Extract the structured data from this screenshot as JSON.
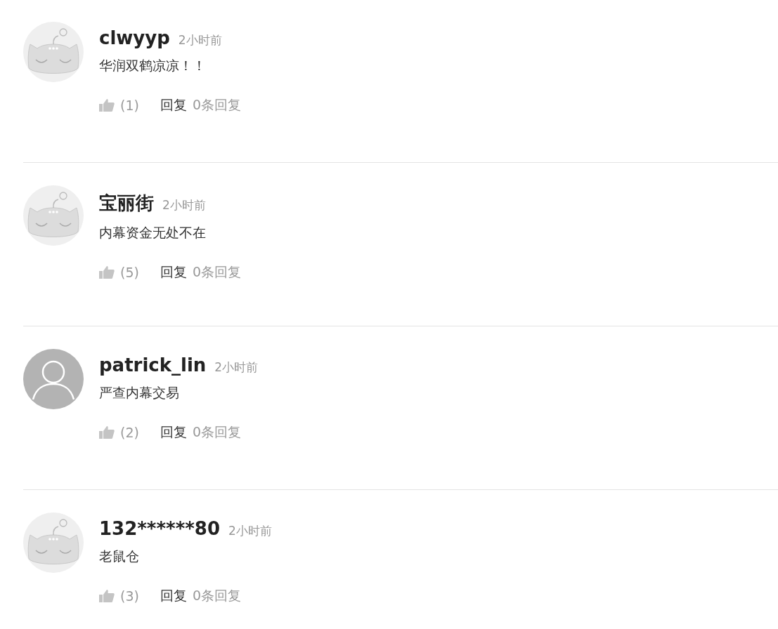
{
  "comments": [
    {
      "avatar": {
        "kind": "mascot"
      },
      "user": "clwyyp",
      "time": "2小时前",
      "text": "华润双鹤凉凉！！",
      "likes": "(1)",
      "reply": "回复",
      "reply_count": "0条回复"
    },
    {
      "avatar": {
        "kind": "mascot"
      },
      "user": "宝丽街",
      "time": "2小时前",
      "text": "内幕资金无处不在",
      "likes": "(5)",
      "reply": "回复",
      "reply_count": "0条回复"
    },
    {
      "avatar": {
        "kind": "person"
      },
      "user": "patrick_lin",
      "time": "2小时前",
      "text": "严查内幕交易",
      "likes": "(2)",
      "reply": "回复",
      "reply_count": "0条回复"
    },
    {
      "avatar": {
        "kind": "mascot"
      },
      "user": "132******80",
      "time": "2小时前",
      "text": "老鼠仓",
      "likes": "(3)",
      "reply": "回复",
      "reply_count": "0条回复"
    }
  ]
}
